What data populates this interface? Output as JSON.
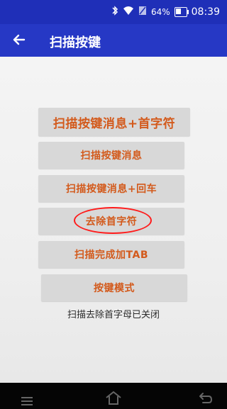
{
  "status_bar": {
    "battery": "64%",
    "time": "08:39",
    "icons": [
      "bluetooth-icon",
      "wifi-icon",
      "sim-icon",
      "battery-icon"
    ]
  },
  "app_bar": {
    "title": "扫描按键",
    "back_icon": "arrow-left-icon"
  },
  "buttons": [
    "扫描按键消息+首字符",
    "扫描按键消息",
    "扫描按键消息+回车",
    "去除首字符",
    "扫描完成加TAB",
    "按键模式"
  ],
  "status_message": "扫描去除首字母已关闭",
  "colors": {
    "app_bar": "#2638c5",
    "button_bg": "#d8d8d8",
    "button_text": "#d35a1c",
    "highlight_circle": "#ff1a1a"
  },
  "nav_bar": {
    "icons": [
      "menu-icon",
      "home-icon",
      "back-icon"
    ]
  }
}
